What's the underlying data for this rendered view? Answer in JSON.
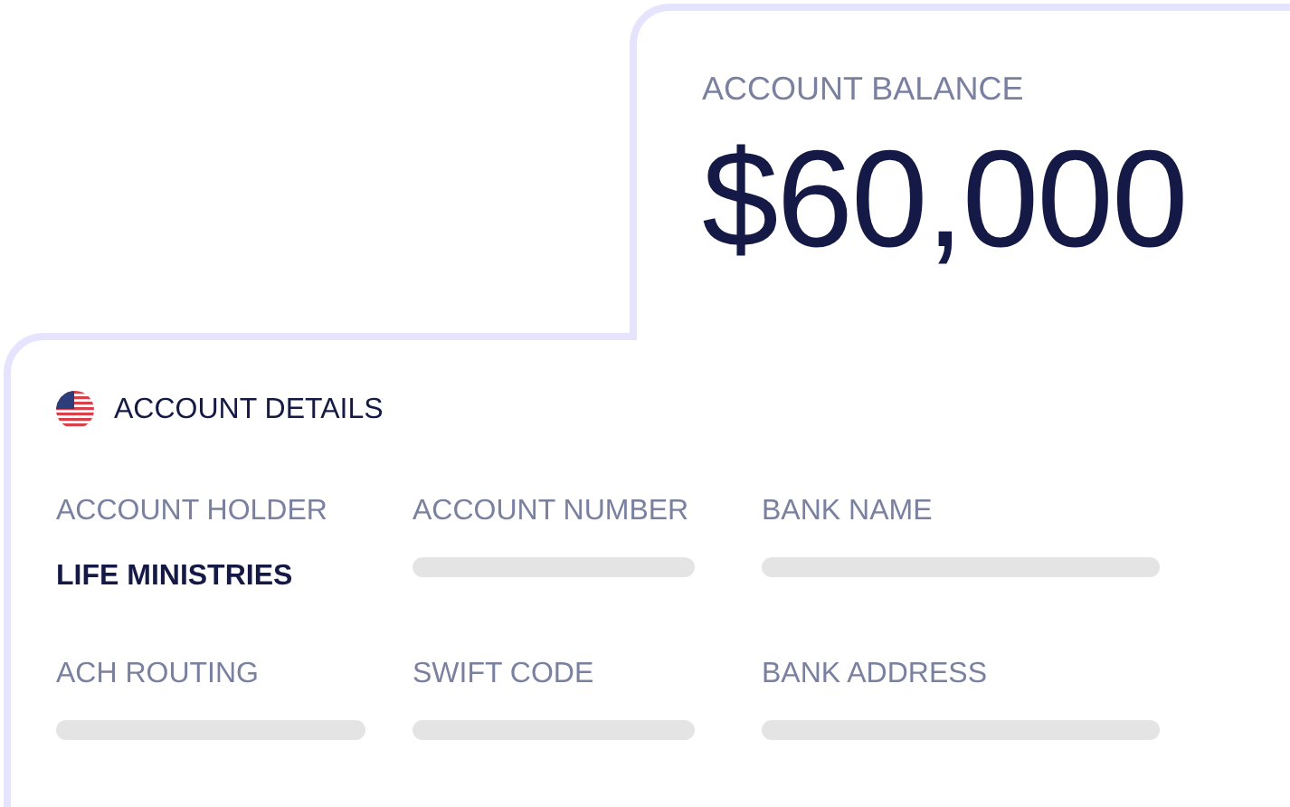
{
  "balance": {
    "label": "ACCOUNT BALANCE",
    "amount": "$60,000"
  },
  "details": {
    "title": "ACCOUNT DETAILS",
    "fields": [
      {
        "label": "ACCOUNT HOLDER",
        "kind": "text",
        "value": "LIFE MINISTRIES"
      },
      {
        "label": "ACCOUNT NUMBER",
        "kind": "skeleton"
      },
      {
        "label": "BANK NAME",
        "kind": "skeleton"
      },
      {
        "label": "ACH ROUTING",
        "kind": "skeleton"
      },
      {
        "label": "SWIFT CODE",
        "kind": "skeleton"
      },
      {
        "label": "BANK ADDRESS",
        "kind": "skeleton"
      }
    ]
  }
}
